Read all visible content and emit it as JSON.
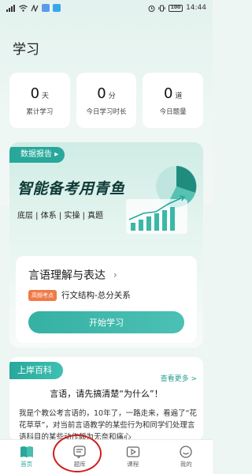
{
  "status_bar": {
    "time": "14:44",
    "battery": "100",
    "icons": [
      "signal-icon",
      "wifi-icon",
      "nfc-icon",
      "app-notification-icon",
      "alarm-icon",
      "vibrate-icon",
      "battery-icon"
    ]
  },
  "page": {
    "title": "学习"
  },
  "stats": [
    {
      "value": "0",
      "unit": "天",
      "label": "累计学习"
    },
    {
      "value": "0",
      "unit": "分",
      "label": "今日学习时长"
    },
    {
      "value": "0",
      "unit": "道",
      "label": "今日题量"
    }
  ],
  "report": {
    "tag": "数据报告",
    "headline": "智能备考用青鱼",
    "subline": "底层 | 体系 | 实操 | 真题"
  },
  "course": {
    "title": "言语理解与表达",
    "badge": "高频考点",
    "topic": "行文结构-总分关系",
    "start_button": "开始学习"
  },
  "news": {
    "tag": "上岸百科",
    "more": "查看更多 >",
    "headline": "言语，请先搞清楚“为什么”！",
    "body": "我是个教公考言语的，10年了，一路走来，看遍了“花花草草”，对当前言语教学的某些行为和同学们处理言语科目的某些动作颇为无奈和痛心"
  },
  "nav": [
    {
      "label": "首页",
      "icon": "book-icon",
      "active": true
    },
    {
      "label": "题库",
      "icon": "question-bank-icon",
      "active": false
    },
    {
      "label": "课程",
      "icon": "video-icon",
      "active": false
    },
    {
      "label": "我的",
      "icon": "smiley-icon",
      "active": false
    }
  ],
  "colors": {
    "accent": "#27a89b",
    "hot_badge": "#f07a47",
    "annotation": "#d01f1f"
  }
}
